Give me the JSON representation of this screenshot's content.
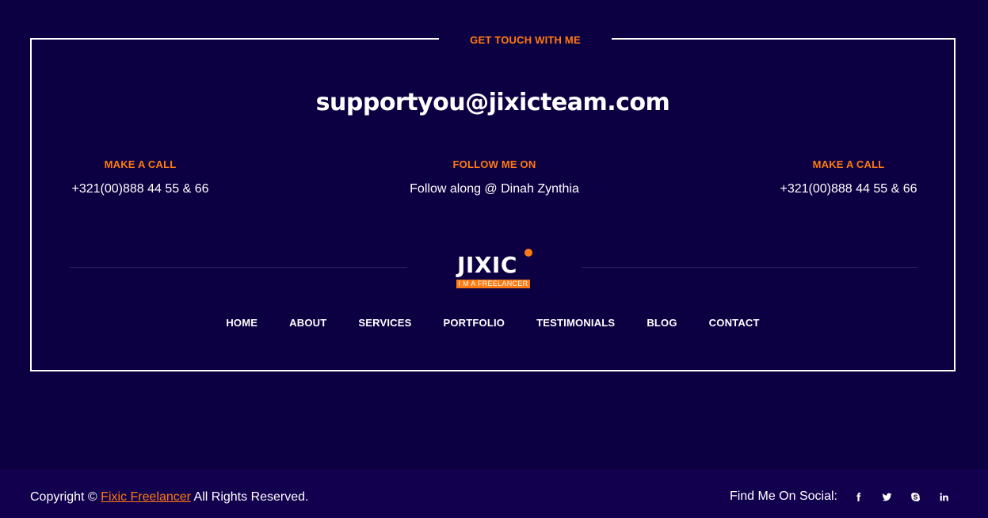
{
  "contact": {
    "legend": "GET TOUCH WITH ME",
    "email": "supportyou@jixicteam.com",
    "columns": [
      {
        "title": "MAKE A CALL",
        "value": "+321(00)888 44 55 & 66"
      },
      {
        "title": "FOLLOW ME ON",
        "value": "Follow along @ Dinah Zynthia"
      },
      {
        "title": "MAKE A CALL",
        "value": "+321(00)888 44 55 & 66"
      }
    ]
  },
  "logo": {
    "name": "JIXIC",
    "tagline": "I M A FREELANCER"
  },
  "nav": {
    "items": [
      "HOME",
      "ABOUT",
      "SERVICES",
      "PORTFOLIO",
      "TESTIMONIALS",
      "BLOG",
      "CONTACT"
    ]
  },
  "footer": {
    "copyright_prefix": "Copyright ©",
    "brand": "Fixic Freelancer",
    "copyright_suffix": "All Rights Reserved.",
    "social_label": "Find Me On Social:",
    "social_icons": [
      "facebook-icon",
      "twitter-icon",
      "skype-icon",
      "linkedin-icon"
    ]
  },
  "colors": {
    "background": "#0d0042",
    "footer_background": "#12004f",
    "accent": "#ff7a12",
    "text": "#ffffff"
  }
}
